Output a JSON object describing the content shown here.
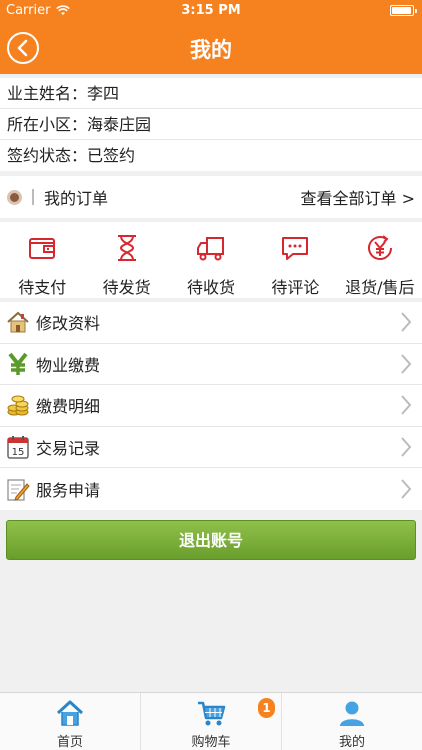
{
  "status_bar": {
    "carrier": "Carrier",
    "time": "3:15 PM"
  },
  "nav": {
    "title": "我的"
  },
  "owner": {
    "rows": [
      {
        "label": "业主姓名：",
        "value": "李四"
      },
      {
        "label": "所在小区：",
        "value": "海泰庄园"
      },
      {
        "label": "签约状态：",
        "value": "已签约"
      }
    ]
  },
  "orders": {
    "title": "我的订单",
    "view_all": "查看全部订单 >",
    "statuses": [
      "待支付",
      "待发货",
      "待收货",
      "待评论",
      "退货/售后"
    ]
  },
  "menu": {
    "items": [
      "修改资料",
      "物业缴费",
      "缴费明细",
      "交易记录",
      "服务申请"
    ],
    "calendar_day": "15"
  },
  "logout_label": "退出账号",
  "tabs": [
    {
      "label": "首页"
    },
    {
      "label": "购物车",
      "badge": "1"
    },
    {
      "label": "我的"
    }
  ],
  "colors": {
    "accent": "#f5821f",
    "icon_red": "#d8282f",
    "logout_green": "#7aad36"
  }
}
